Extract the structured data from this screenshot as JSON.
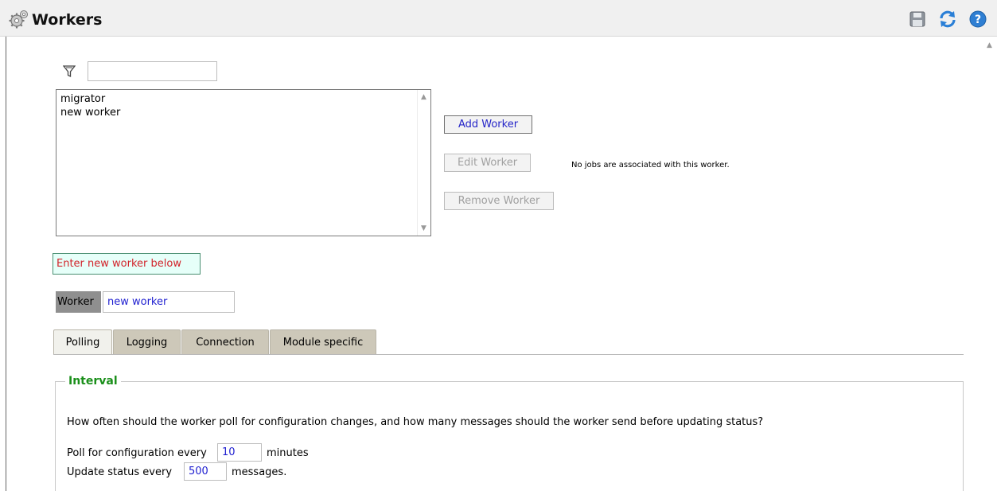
{
  "window": {
    "title": "Workers"
  },
  "toolbar": {
    "save_icon": "save-icon",
    "refresh_icon": "refresh-icon",
    "help_icon": "help-icon"
  },
  "filter": {
    "icon": "filter-icon",
    "value": ""
  },
  "workers_list": {
    "items": [
      "migrator",
      "new worker"
    ]
  },
  "buttons": {
    "add": "Add Worker",
    "edit": "Edit Worker",
    "remove": "Remove Worker"
  },
  "status_note": "No jobs are associated with this worker.",
  "hint": "Enter new worker below",
  "worker_field": {
    "label": "Worker",
    "value": "new worker"
  },
  "tabs": [
    {
      "label": "Polling",
      "active": true
    },
    {
      "label": "Logging",
      "active": false
    },
    {
      "label": "Connection",
      "active": false
    },
    {
      "label": "Module specific",
      "active": false
    }
  ],
  "interval": {
    "legend": "Interval",
    "question": "How often should the worker poll for configuration changes, and how many messages should the worker send before updating status?",
    "poll_prefix": "Poll for configuration every",
    "poll_value": "10",
    "poll_suffix": "minutes",
    "status_prefix": "Update status every",
    "status_value": "500",
    "status_suffix": "messages."
  },
  "colors": {
    "accent_blue": "#2424c8",
    "value_blue": "#1f1fd0",
    "hint_red": "#d2232a",
    "legend_green": "#1a8f1a",
    "active_tab": "#f1f1ec",
    "inactive_tab": "#cdc8b9"
  }
}
